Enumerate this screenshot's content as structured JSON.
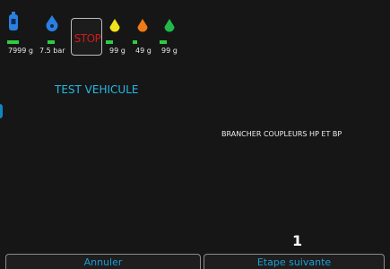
{
  "status_bar": {
    "gauges": [
      {
        "icon": "gas-cylinder-icon",
        "color": "#2b7fe0",
        "value": "7999 g"
      },
      {
        "icon": "pressure-drop-icon",
        "color": "#2b7fe0",
        "value": "7.5 bar"
      },
      {
        "icon": "yellow-drop-icon",
        "color": "#f2e21b",
        "value": "99 g"
      },
      {
        "icon": "orange-drop-icon",
        "color": "#f07a18",
        "value": "49 g"
      },
      {
        "icon": "green-drop-icon",
        "color": "#22b84a",
        "value": "99 g"
      }
    ],
    "stop_label": "STOP",
    "level_color": "#2ecc40"
  },
  "main": {
    "title": "TEST VEHICULE",
    "instruction": "BRANCHER COUPLEURS HP ET BP",
    "step_number": "1"
  },
  "footer": {
    "cancel_label": "Annuler",
    "next_label": "Etape suivante"
  },
  "colors": {
    "background": "#161616",
    "accent": "#1b9ed6",
    "stop": "#d11a1a"
  }
}
